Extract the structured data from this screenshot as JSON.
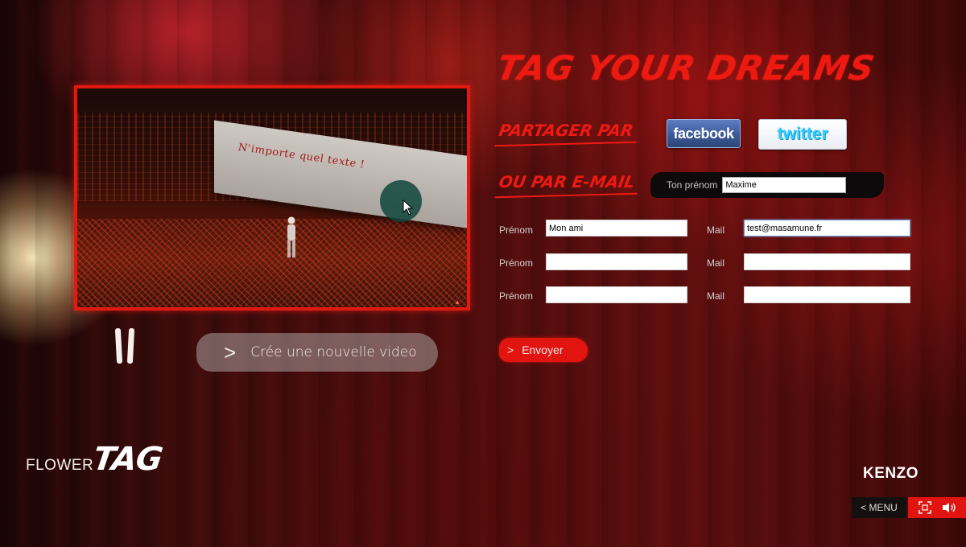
{
  "video": {
    "banner_text": "N'importe quel texte !"
  },
  "controls": {
    "new_video_label": "Crée une nouvelle video",
    "new_video_icon": "chevron-right-icon",
    "pause_icon": "pause-icon"
  },
  "logo": {
    "flower": "FLOWER",
    "tag": "TAG"
  },
  "panel": {
    "title": "TAG YOUR DREAMS",
    "share_label": "PARTAGER PAR",
    "facebook_label": "facebook",
    "twitter_label": "twitter",
    "mail_label": "OU PAR E-MAIL",
    "your_firstname_label": "Ton prénom",
    "your_firstname_value": "Maxime",
    "rows": [
      {
        "firstname_label": "Prénom",
        "firstname_value": "Mon ami",
        "mail_label": "Mail",
        "mail_value": "test@masamune.fr"
      },
      {
        "firstname_label": "Prénom",
        "firstname_value": "",
        "mail_label": "Mail",
        "mail_value": ""
      },
      {
        "firstname_label": "Prénom",
        "firstname_value": "",
        "mail_label": "Mail",
        "mail_value": ""
      }
    ],
    "send_label": "Envoyer"
  },
  "footer": {
    "brand": "KENZO",
    "menu_label": "< MENU",
    "fullscreen_icon": "fullscreen-icon",
    "sound_icon": "speaker-icon"
  },
  "colors": {
    "accent_red": "#ee1a12",
    "facebook_blue": "#3b5998",
    "twitter_cyan": "#33ccff"
  }
}
